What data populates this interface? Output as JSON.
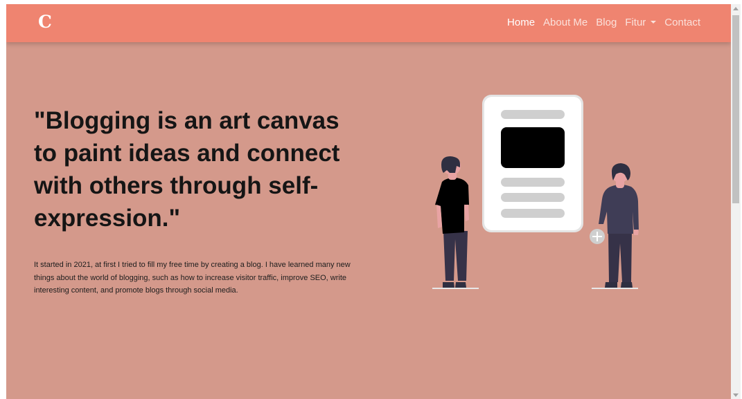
{
  "navbar": {
    "brand": "C",
    "links": [
      {
        "label": "Home",
        "active": true
      },
      {
        "label": "About Me",
        "active": false
      },
      {
        "label": "Blog",
        "active": false
      },
      {
        "label": "Fitur",
        "active": false,
        "dropdown": true
      },
      {
        "label": "Contact",
        "active": false
      }
    ]
  },
  "hero": {
    "headline": "\"Blogging is an art canvas to paint ideas and connect with others through self-expression.\"",
    "paragraph": "It started in 2021, at first I tried to fill my free time by creating a blog. I have learned many new things about the world of blogging, such as how to increase visitor traffic, improve SEO, write interesting content, and promote blogs through social media."
  },
  "colors": {
    "navbar_bg": "#ef8470",
    "page_bg": "#d4998b",
    "headline_text": "#151515",
    "nav_active": "#ffffff"
  },
  "icons": {
    "illustration": "two-people-viewing-document-illustration",
    "dropdown": "caret-down-icon"
  }
}
